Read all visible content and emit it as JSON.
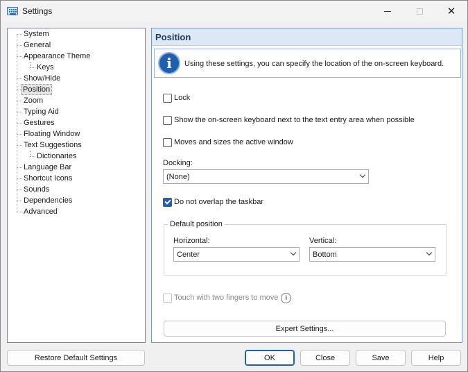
{
  "window": {
    "title": "Settings",
    "icon": "keyboard-icon"
  },
  "tree": {
    "items": [
      {
        "label": "System",
        "level": 0
      },
      {
        "label": "General",
        "level": 0
      },
      {
        "label": "Appearance Theme",
        "level": 0
      },
      {
        "label": "Keys",
        "level": 1
      },
      {
        "label": "Show/Hide",
        "level": 0
      },
      {
        "label": "Position",
        "level": 0,
        "selected": true
      },
      {
        "label": "Zoom",
        "level": 0
      },
      {
        "label": "Typing Aid",
        "level": 0
      },
      {
        "label": "Gestures",
        "level": 0
      },
      {
        "label": "Floating Window",
        "level": 0
      },
      {
        "label": "Text Suggestions",
        "level": 0
      },
      {
        "label": "Dictionaries",
        "level": 1
      },
      {
        "label": "Language Bar",
        "level": 0
      },
      {
        "label": "Shortcut Icons",
        "level": 0
      },
      {
        "label": "Sounds",
        "level": 0
      },
      {
        "label": "Dependencies",
        "level": 0
      },
      {
        "label": "Advanced",
        "level": 0
      }
    ]
  },
  "panel": {
    "title": "Position",
    "info": "Using these settings, you can specify the location of the on-screen keyboard.",
    "lock_label": "Lock",
    "lock_checked": false,
    "next_to_entry_label": "Show the on-screen keyboard next to the text entry area when possible",
    "next_to_entry_checked": false,
    "moves_sizes_label": "Moves and sizes the active window",
    "moves_sizes_checked": false,
    "docking_label": "Docking:",
    "docking_value": "(None)",
    "no_overlap_label": "Do not overlap the taskbar",
    "no_overlap_checked": true,
    "default_position": {
      "title": "Default position",
      "horizontal_label": "Horizontal:",
      "horizontal_value": "Center",
      "vertical_label": "Vertical:",
      "vertical_value": "Bottom"
    },
    "touch_two_fingers_label": "Touch with two fingers to move",
    "touch_two_fingers_checked": false,
    "touch_two_fingers_enabled": false,
    "expert_button": "Expert Settings..."
  },
  "footer": {
    "restore_button": "Restore Default Settings",
    "ok_button": "OK",
    "close_button": "Close",
    "save_button": "Save",
    "help_button": "Help"
  },
  "colors": {
    "accent": "#1f5fae",
    "header_bg": "#dde8f6",
    "header_text": "#1e395b"
  }
}
